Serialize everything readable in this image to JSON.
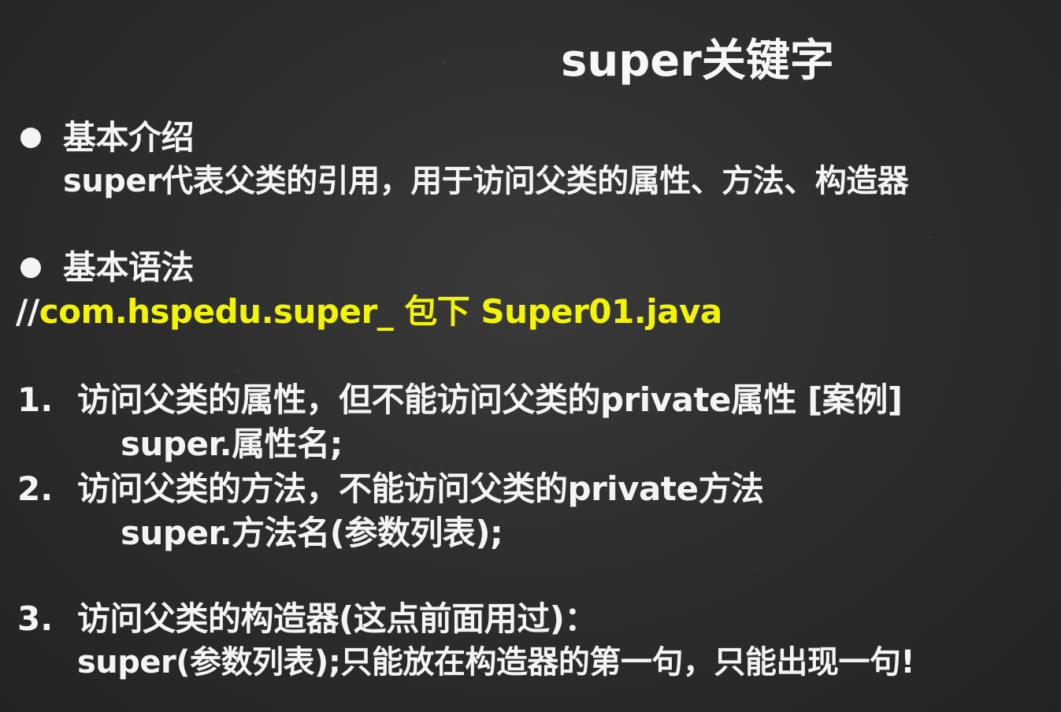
{
  "title": "super关键字",
  "section1": {
    "heading": "基本介绍",
    "body": "super代表父类的引用，用于访问父类的属性、方法、构造器"
  },
  "section2": {
    "heading": "基本语法",
    "path_prefix": "//",
    "path_text": "com.hspedu.super_ 包下  Super01.java"
  },
  "items": [
    {
      "number": "1.",
      "text": "访问父类的属性，但不能访问父类的private属性 [案例]",
      "code": "super.属性名;"
    },
    {
      "number": "2.",
      "text": "访问父类的方法，不能访问父类的private方法",
      "code": "super.方法名(参数列表);"
    },
    {
      "number": "3.",
      "text": "访问父类的构造器(这点前面用过)：",
      "code": "super(参数列表);只能放在构造器的第一句，只能出现一句!"
    }
  ],
  "colors": {
    "background": "#2e2e2e",
    "text": "#f4f4f4",
    "highlight": "#f3f500"
  }
}
